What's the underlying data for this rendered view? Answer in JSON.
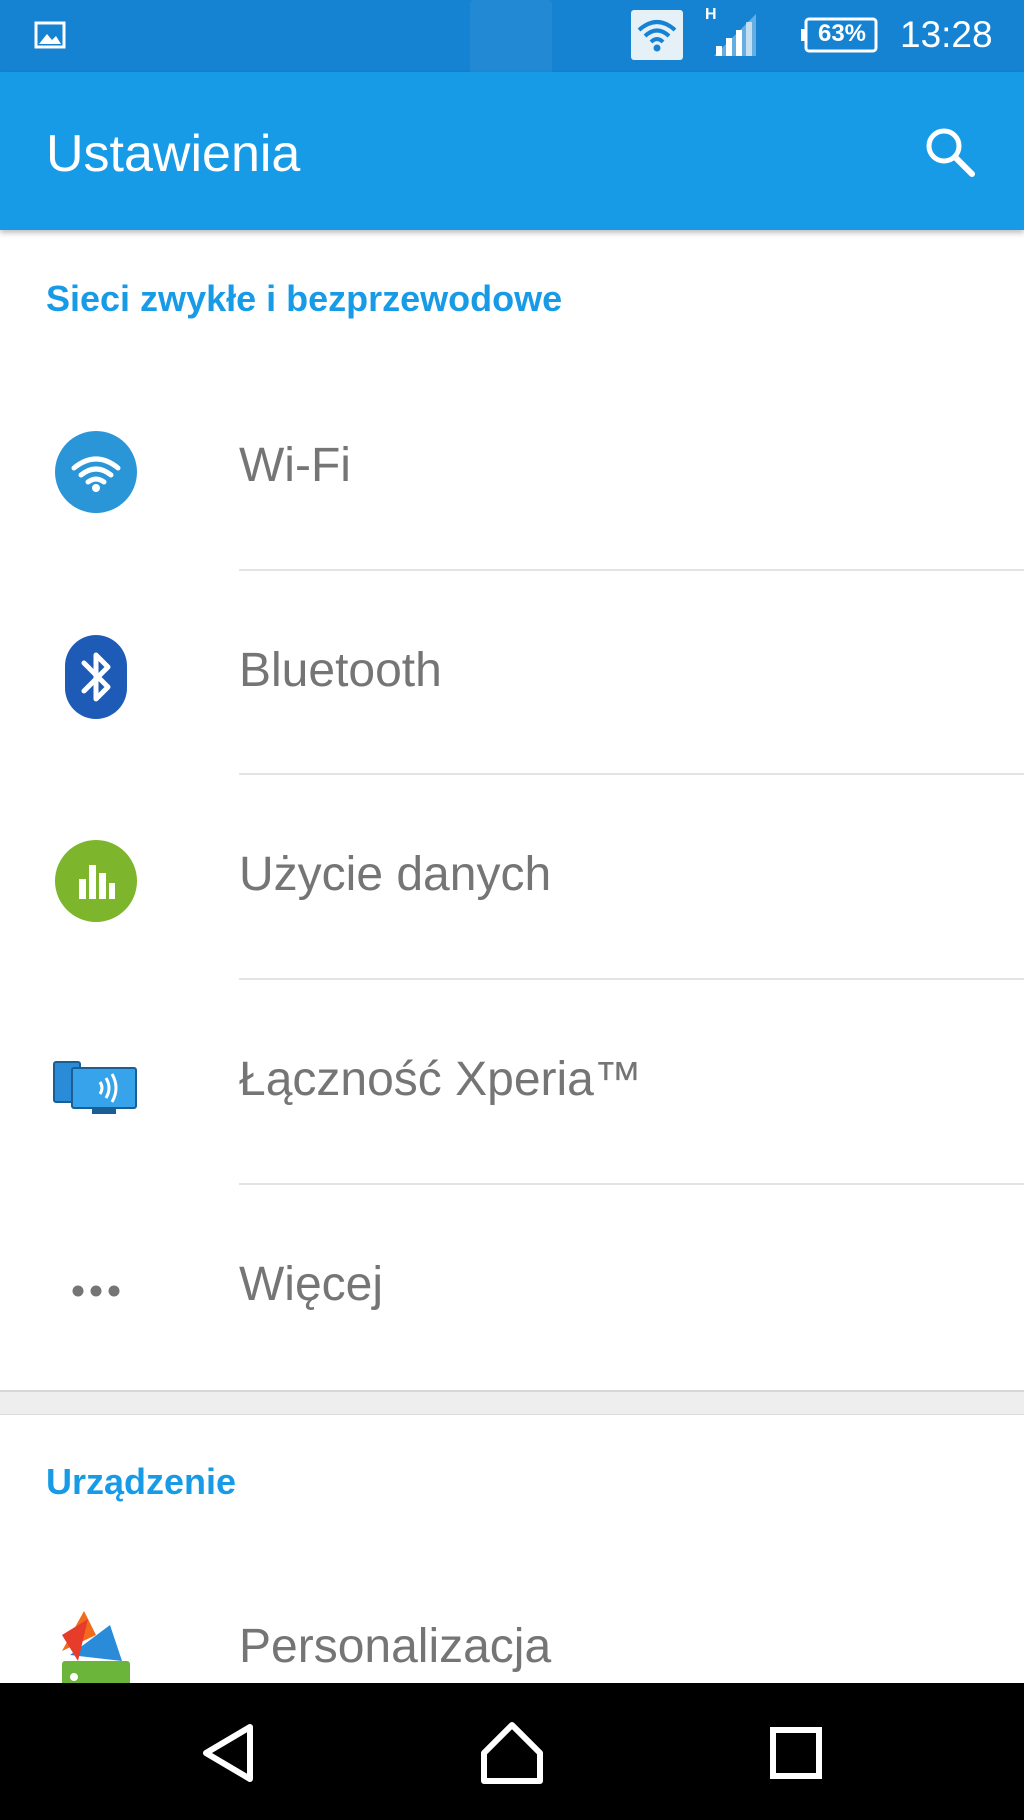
{
  "status_bar": {
    "network_type": "H",
    "battery": "63%",
    "time": "13:28",
    "icons": [
      "image-notification-icon",
      "wifi-icon",
      "signal-icon",
      "battery-icon"
    ]
  },
  "app_bar": {
    "title": "Ustawienia",
    "search_icon": "search-icon"
  },
  "sections": [
    {
      "title": "Sieci zwykłe i bezprzewodowe",
      "items": [
        {
          "label": "Wi-Fi",
          "icon": "wifi-icon",
          "color": "#2a96d8"
        },
        {
          "label": "Bluetooth",
          "icon": "bluetooth-icon",
          "color": "#1e5bb6"
        },
        {
          "label": "Użycie danych",
          "icon": "data-usage-icon",
          "color": "#7db52c"
        },
        {
          "label": "Łączność Xperia™",
          "icon": "xperia-connectivity-icon",
          "color": "#2a8cd8"
        },
        {
          "label": "Więcej",
          "icon": "more-icon",
          "color": "#757575"
        }
      ]
    },
    {
      "title": "Urządzenie",
      "items": [
        {
          "label": "Personalizacja",
          "icon": "personalization-icon",
          "color": "#f26b1d"
        }
      ]
    }
  ],
  "nav_bar": {
    "buttons": [
      "back-icon",
      "home-icon",
      "recents-icon"
    ]
  },
  "colors": {
    "status_bar": "#1582d2",
    "app_bar": "#189be7",
    "section_header": "#189be7",
    "item_text": "#757575",
    "nav_bar": "#000000"
  }
}
